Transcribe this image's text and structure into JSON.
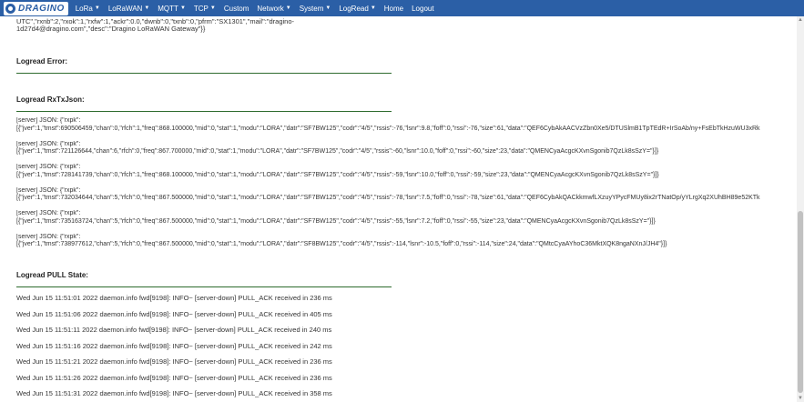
{
  "brand": {
    "name": "DRAGINO"
  },
  "nav": {
    "items": [
      {
        "label": "LoRa",
        "dropdown": true
      },
      {
        "label": "LoRaWAN",
        "dropdown": true
      },
      {
        "label": "MQTT",
        "dropdown": true
      },
      {
        "label": "TCP",
        "dropdown": true
      },
      {
        "label": "Custom",
        "dropdown": false
      },
      {
        "label": "Network",
        "dropdown": true
      },
      {
        "label": "System",
        "dropdown": true
      },
      {
        "label": "LogRead",
        "dropdown": true
      },
      {
        "label": "Home",
        "dropdown": false
      },
      {
        "label": "Logout",
        "dropdown": false
      }
    ]
  },
  "top_text": {
    "line1": "UTC\",\"rxnb\":2,\"rxok\":1,\"rxfw\":1,\"ackr\":0.0,\"dwnb\":0,\"txnb\":0,\"pfrm\":\"SX1301\",\"mail\":\"dragino-",
    "line2": "1d27d4@dragino.com\",\"desc\":\"Dragino LoRaWAN Gateway\"}}"
  },
  "sections": {
    "error_title": "Logread Error:",
    "rxtx_title": "Logread RxTxJson:",
    "pull_title": "Logread PULL State:"
  },
  "rxtx_entries": [
    {
      "prefix": "[server] JSON: {\"rxpk\":",
      "body": "[{\"jver\":1,\"tmst\":690506459,\"chan\":0,\"rfch\":1,\"freq\":868.100000,\"mid\":0,\"stat\":1,\"modu\":\"LORA\",\"datr\":\"SF7BW125\",\"codr\":\"4/5\",\"rssis\":-76,\"lsnr\":9.8,\"foff\":0,\"rssi\":-76,\"size\":61,\"data\":\"QEF6CybAkAACVzZbn0Xe5/DTUSlmB1TpTEdR+IrSoAb/ny+FsEbTkHzuWU3xRk"
    },
    {
      "prefix": "[server] JSON: {\"rxpk\":",
      "body": "[{\"jver\":1,\"tmst\":721126644,\"chan\":6,\"rfch\":0,\"freq\":867.700000,\"mid\":0,\"stat\":1,\"modu\":\"LORA\",\"datr\":\"SF7BW125\",\"codr\":\"4/5\",\"rssis\":-60,\"lsnr\":10.0,\"foff\":0,\"rssi\":-60,\"size\":23,\"data\":\"QMENCyaAcgcKXvnSgonib7QzLk8sSzY=\"}]}"
    },
    {
      "prefix": "[server] JSON: {\"rxpk\":",
      "body": "[{\"jver\":1,\"tmst\":728141739,\"chan\":0,\"rfch\":1,\"freq\":868.100000,\"mid\":0,\"stat\":1,\"modu\":\"LORA\",\"datr\":\"SF7BW125\",\"codr\":\"4/5\",\"rssis\":-59,\"lsnr\":10.0,\"foff\":0,\"rssi\":-59,\"size\":23,\"data\":\"QMENCyaAcgcKXvnSgonib7QzLk8sSzY=\"}]}"
    },
    {
      "prefix": "[server] JSON: {\"rxpk\":",
      "body": "[{\"jver\":1,\"tmst\":732034644,\"chan\":5,\"rfch\":0,\"freq\":867.500000,\"mid\":0,\"stat\":1,\"modu\":\"LORA\",\"datr\":\"SF7BW125\",\"codr\":\"4/5\",\"rssis\":-78,\"lsnr\":7.5,\"foff\":0,\"rssi\":-78,\"size\":61,\"data\":\"QEF6CybAkQACkkmwfLXzuyYPycFMUy8ix2rTNatOp/yYLrgXq2XUhBH89e52KTk"
    },
    {
      "prefix": "[server] JSON: {\"rxpk\":",
      "body": "[{\"jver\":1,\"tmst\":735163724,\"chan\":5,\"rfch\":0,\"freq\":867.500000,\"mid\":0,\"stat\":1,\"modu\":\"LORA\",\"datr\":\"SF7BW125\",\"codr\":\"4/5\",\"rssis\":-55,\"lsnr\":7.2,\"foff\":0,\"rssi\":-55,\"size\":23,\"data\":\"QMENCyaAcgcKXvnSgonib7QzLk8sSzY=\"}]}"
    },
    {
      "prefix": "[server] JSON: {\"rxpk\":",
      "body": "[{\"jver\":1,\"tmst\":738977612,\"chan\":5,\"rfch\":0,\"freq\":867.500000,\"mid\":0,\"stat\":1,\"modu\":\"LORA\",\"datr\":\"SF8BW125\",\"codr\":\"4/5\",\"rssis\":-114,\"lsnr\":-10.5,\"foff\":0,\"rssi\":-114,\"size\":24,\"data\":\"QMtcCyaAYhoC36MktXQK8ngaNXnJ/JH4\"}]}"
    }
  ],
  "pull_lines": [
    "Wed Jun 15 11:51:01 2022 daemon.info fwd[9198]: INFO~ [server-down] PULL_ACK received in 236 ms",
    "Wed Jun 15 11:51:06 2022 daemon.info fwd[9198]: INFO~ [server-down] PULL_ACK received in 405 ms",
    "Wed Jun 15 11:51:11 2022 daemon.info fwd[9198]: INFO~ [server-down] PULL_ACK received in 240 ms",
    "Wed Jun 15 11:51:16 2022 daemon.info fwd[9198]: INFO~ [server-down] PULL_ACK received in 242 ms",
    "Wed Jun 15 11:51:21 2022 daemon.info fwd[9198]: INFO~ [server-down] PULL_ACK received in 236 ms",
    "Wed Jun 15 11:51:26 2022 daemon.info fwd[9198]: INFO~ [server-down] PULL_ACK received in 236 ms",
    "Wed Jun 15 11:51:31 2022 daemon.info fwd[9198]: INFO~ [server-down] PULL_ACK received in 358 ms"
  ],
  "colors": {
    "navbar": "#2b5fa6",
    "rule": "#2e6b2e"
  }
}
